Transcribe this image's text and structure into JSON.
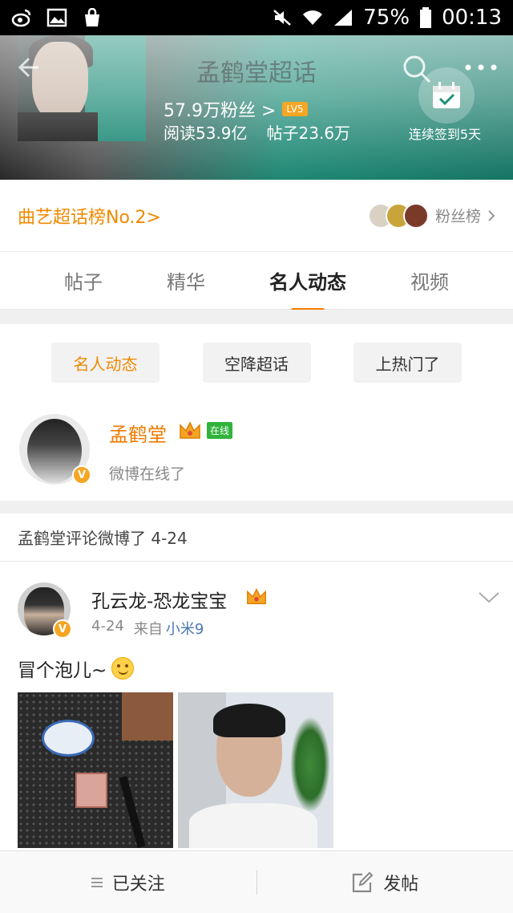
{
  "status_bar": {
    "battery": "75%",
    "time": "00:13"
  },
  "header": {
    "title": "孟鹤堂超话",
    "fans": "57.9万粉丝 >",
    "level": "LV5",
    "reads": "阅读53.9亿",
    "posts": "帖子23.6万",
    "checkin": "连续签到5天"
  },
  "ranking": {
    "text": "曲艺超话榜No.2>",
    "fan_rank": "粉丝榜"
  },
  "tabs": [
    {
      "label": "帖子"
    },
    {
      "label": "精华"
    },
    {
      "label": "名人动态"
    },
    {
      "label": "视频"
    }
  ],
  "filters": [
    {
      "label": "名人动态"
    },
    {
      "label": "空降超话"
    },
    {
      "label": "上热门了"
    }
  ],
  "celebrity": {
    "name": "孟鹤堂",
    "online_badge": "在线",
    "status": "微博在线了"
  },
  "activity": {
    "text": "孟鹤堂评论微博了 4-24"
  },
  "post": {
    "author": "孔云龙-恐龙宝宝",
    "date": "4-24",
    "source_prefix": "来自",
    "device": "小米9",
    "text": "冒个泡儿~"
  },
  "bottom_bar": {
    "follow_label": "已关注",
    "compose_label": "发帖"
  },
  "colors": {
    "accent": "#f57a00",
    "header_teal": "#1f8f7a",
    "online_green": "#2fb33c"
  }
}
